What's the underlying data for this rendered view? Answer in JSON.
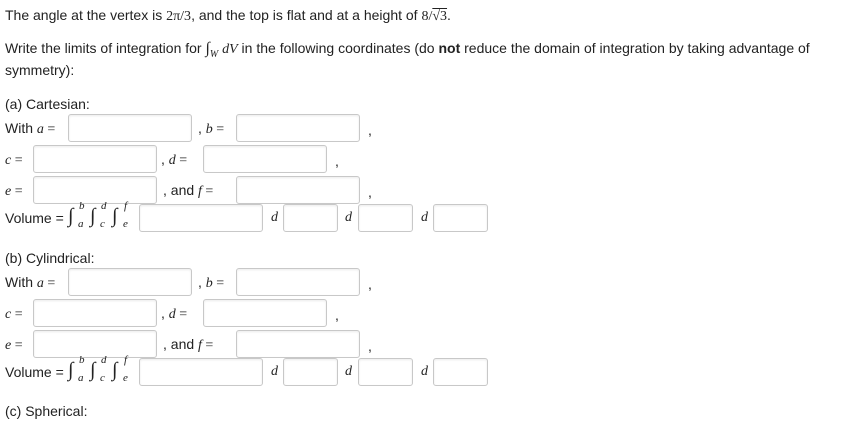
{
  "intro": {
    "line1_prefix": "The angle at the vertex is ",
    "vertex_angle": "2π/3",
    "line1_middle": ", and the top is flat and at a height of ",
    "height_num": "8/",
    "height_rad": "√3",
    "height_end": "."
  },
  "instructions": {
    "prefix": "Write the limits of integration for ",
    "integral_symbol": "∫",
    "integral_sub": "W",
    "integrand": "dV",
    "middle": " in the following coordinates (do ",
    "bold_not": "not",
    "suffix": " reduce the domain of integration by taking advantage of",
    "line2": "symmetry):"
  },
  "sections": [
    {
      "heading": "(a) Cartesian:",
      "with_a_label": "With ",
      "a_var": "a",
      "eq": " =",
      "b_label_comma": ", ",
      "b_var": "b",
      "c_var": "c",
      "d_var": "d",
      "e_var": "e",
      "and_f": ", and ",
      "f_var": "f",
      "comma": ",",
      "volume_label": "Volume = ",
      "d_text": "d",
      "upper1": "b",
      "lower1": "a",
      "upper2": "d",
      "lower2": "c",
      "upper3": "f",
      "lower3": "e"
    },
    {
      "heading": "(b) Cylindrical:",
      "with_a_label": "With ",
      "a_var": "a",
      "eq": " =",
      "b_label_comma": ", ",
      "b_var": "b",
      "c_var": "c",
      "d_var": "d",
      "e_var": "e",
      "and_f": ", and ",
      "f_var": "f",
      "comma": ",",
      "volume_label": "Volume = ",
      "d_text": "d",
      "upper1": "b",
      "lower1": "a",
      "upper2": "d",
      "lower2": "c",
      "upper3": "f",
      "lower3": "e"
    },
    {
      "heading": "(c) Spherical:"
    }
  ],
  "inputs": {
    "value": ""
  }
}
